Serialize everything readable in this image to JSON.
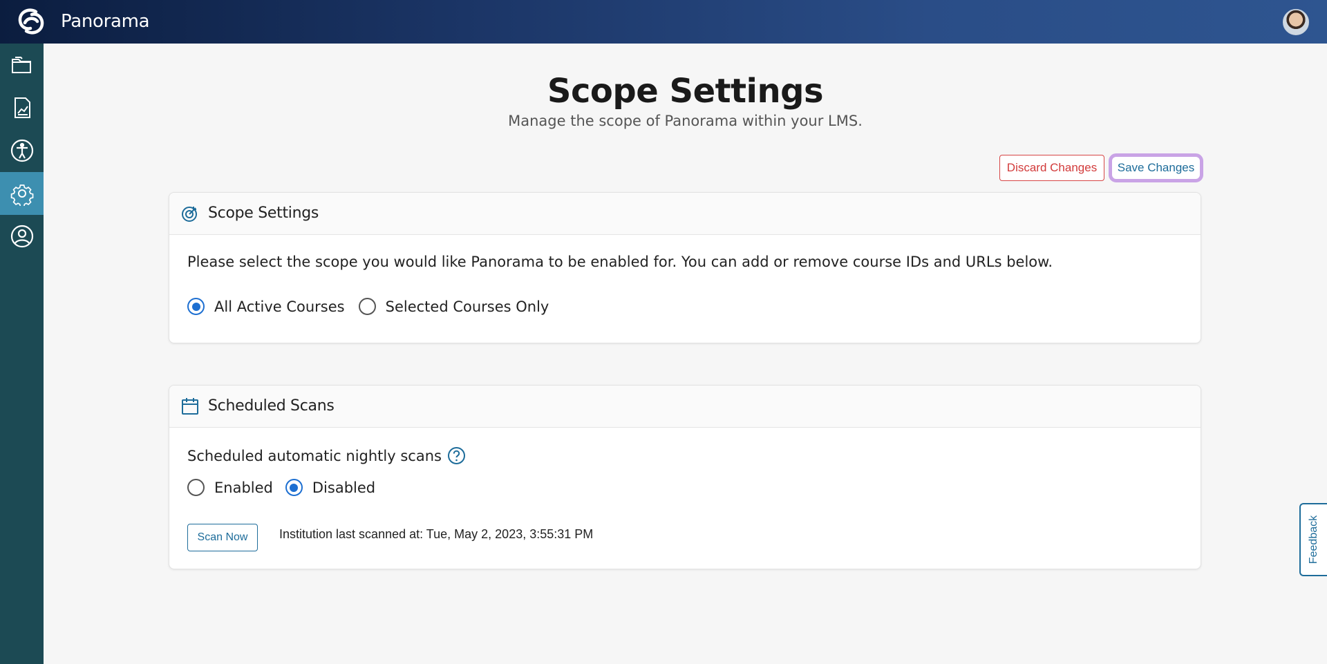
{
  "header": {
    "app_title": "Panorama",
    "logo_icon": "panorama-logo-icon",
    "avatar_icon": "user-avatar"
  },
  "sidebar": {
    "items": [
      {
        "name": "folders",
        "icon": "folder-icon",
        "active": false
      },
      {
        "name": "reports",
        "icon": "chart-report-icon",
        "active": false
      },
      {
        "name": "accessibility",
        "icon": "accessibility-icon",
        "active": false
      },
      {
        "name": "settings",
        "icon": "gear-icon",
        "active": true
      },
      {
        "name": "account",
        "icon": "user-circle-icon",
        "active": false
      }
    ]
  },
  "page": {
    "title": "Scope Settings",
    "subtitle": "Manage the scope of Panorama within your LMS."
  },
  "actions": {
    "discard_label": "Discard Changes",
    "save_label": "Save Changes"
  },
  "scope_card": {
    "title": "Scope Settings",
    "icon": "target-icon",
    "description": "Please select the scope you would like Panorama to be enabled for. You can add or remove course IDs and URLs below.",
    "options": [
      {
        "label": "All Active Courses",
        "checked": true
      },
      {
        "label": "Selected Courses Only",
        "checked": false
      }
    ]
  },
  "scans_card": {
    "title": "Scheduled Scans",
    "icon": "calendar-icon",
    "nightly_label": "Scheduled automatic nightly scans",
    "options": [
      {
        "label": "Enabled",
        "checked": false
      },
      {
        "label": "Disabled",
        "checked": true
      }
    ],
    "scan_now_label": "Scan Now",
    "last_scanned": "Institution last scanned at: Tue, May 2, 2023, 3:55:31 PM"
  },
  "feedback": {
    "label": "Feedback"
  },
  "colors": {
    "accent": "#1d6c9a",
    "sidebar_bg": "#1c4a54",
    "sidebar_active": "#3d8fb0",
    "danger": "#d23a3a",
    "radio_checked": "#1d6fd1",
    "focus_ring": "#c9a3e6"
  }
}
